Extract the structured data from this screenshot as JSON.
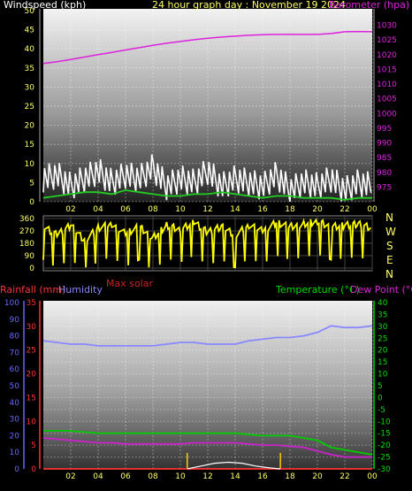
{
  "header": {
    "left": "Windspeed (kph)",
    "center": "24 hour graph day : November 19 2024",
    "right": "Barometer (hpa)"
  },
  "colors": {
    "barometer": "#dd22dd",
    "wind": "#ffffff",
    "wind_avg": "#22cc22",
    "direction": "#ffff00",
    "humidity": "#8888ff",
    "temperature": "#00cc00",
    "dewpoint": "#cc22cc",
    "rainfall": "#ff3333",
    "solar": "#ffffff",
    "axis_yellow": "#ffff66",
    "axis_green": "#00dd00",
    "axis_magenta": "#dd22dd",
    "axis_blue": "#6666ff",
    "axis_red": "#ff3333"
  },
  "x_ticks": [
    "02",
    "04",
    "06",
    "08",
    "10",
    "12",
    "14",
    "16",
    "18",
    "20",
    "22",
    "00"
  ],
  "panel2_labels": {
    "compass": [
      "N",
      "W",
      "S",
      "E",
      "N"
    ],
    "max_solar": "Max solar"
  },
  "panel3_header": {
    "rainfall": "Rainfall (mm)",
    "humidity": "Humidity",
    "temperature": "Temperature (°C)",
    "dewpoint": "Dew Point (°C)"
  },
  "chart_data": [
    {
      "type": "line",
      "x_range_hours": [
        0,
        24
      ],
      "axes": {
        "left": {
          "label": "Windspeed (kph)",
          "ylim": [
            0,
            50
          ],
          "ticks": [
            "0",
            "5",
            "10",
            "15",
            "20",
            "25",
            "30",
            "35",
            "40",
            "45",
            "50"
          ]
        },
        "right": {
          "label": "Barometer (hpa)",
          "ylim": [
            970,
            1035
          ],
          "ticks": [
            "975",
            "980",
            "985",
            "990",
            "995",
            "1000",
            "1005",
            "1010",
            "1015",
            "1020",
            "1025",
            "1030"
          ]
        }
      },
      "series": [
        {
          "name": "Barometer (hpa)",
          "axis": "right",
          "color": "#dd22dd",
          "x": [
            0,
            1,
            2,
            3,
            4,
            5,
            6,
            7,
            8,
            9,
            10,
            11,
            12,
            13,
            14,
            15,
            16,
            17,
            18,
            19,
            20,
            21,
            22,
            23,
            24
          ],
          "y": [
            1017,
            1017.6,
            1018.4,
            1019.2,
            1020,
            1020.8,
            1021.6,
            1022.4,
            1023.2,
            1023.9,
            1024.5,
            1025.1,
            1025.6,
            1026,
            1026.3,
            1026.6,
            1026.8,
            1026.9,
            1026.9,
            1026.9,
            1026.9,
            1027.2,
            1027.8,
            1027.9,
            1027.8
          ]
        },
        {
          "name": "Windspeed (kph)",
          "axis": "left",
          "color": "#ffffff",
          "x": [
            0,
            1,
            2,
            3,
            4,
            5,
            6,
            7,
            8,
            9,
            10,
            11,
            12,
            13,
            14,
            15,
            16,
            17,
            18,
            19,
            20,
            21,
            22,
            23,
            24
          ],
          "y": [
            6,
            7,
            4,
            6,
            8,
            5,
            7,
            6,
            9,
            4,
            6,
            5,
            8,
            4,
            6,
            5,
            4,
            7,
            3,
            5,
            4,
            6,
            3,
            5,
            4
          ]
        },
        {
          "name": "Average windspeed",
          "axis": "left",
          "color": "#22cc22",
          "x": [
            0,
            1,
            2,
            3,
            4,
            5,
            6,
            7,
            8,
            9,
            10,
            11,
            12,
            13,
            14,
            15,
            16,
            17,
            18,
            19,
            20,
            21,
            22,
            23,
            24
          ],
          "y": [
            1,
            1.5,
            2,
            2.5,
            2.5,
            2,
            3,
            2.5,
            2,
            1.5,
            1.5,
            2,
            2,
            2.5,
            2,
            1.5,
            1,
            1.5,
            1.5,
            1,
            1,
            1,
            0.5,
            1,
            1
          ]
        }
      ]
    },
    {
      "type": "line",
      "x_range_hours": [
        0,
        24
      ],
      "axes": {
        "left": {
          "ylim": [
            0,
            360
          ],
          "ticks": [
            "0",
            "90",
            "180",
            "270",
            "360"
          ]
        }
      },
      "series": [
        {
          "name": "Wind direction",
          "color": "#ffff00",
          "x": [
            0,
            1,
            2,
            3,
            4,
            5,
            6,
            7,
            8,
            9,
            10,
            11,
            12,
            13,
            14,
            15,
            16,
            17,
            18,
            19,
            20,
            21,
            22,
            23,
            24
          ],
          "y": [
            300,
            240,
            310,
            200,
            290,
            320,
            250,
            300,
            220,
            310,
            280,
            330,
            260,
            300,
            240,
            310,
            270,
            330,
            300,
            320,
            340,
            300,
            310,
            320,
            290
          ]
        }
      ]
    },
    {
      "type": "line",
      "x_range_hours": [
        0,
        24
      ],
      "axes": {
        "left_outer": {
          "label": "Humidity",
          "ylim": [
            0,
            100
          ],
          "ticks": [
            "0",
            "10",
            "20",
            "30",
            "40",
            "50",
            "60",
            "70",
            "80",
            "90",
            "100"
          ]
        },
        "left_inner": {
          "label": "Rainfall (mm)",
          "ylim": [
            0,
            35
          ],
          "ticks": [
            "0",
            "5",
            "10",
            "15",
            "20",
            "25",
            "30",
            "35"
          ]
        },
        "right": {
          "label": "Temperature (°C)",
          "ylim": [
            -30,
            40
          ],
          "ticks": [
            "-30",
            "-25",
            "-20",
            "-15",
            "-10",
            "-5",
            "0",
            "5",
            "10",
            "15",
            "20",
            "25",
            "30",
            "35",
            "40"
          ]
        }
      },
      "series": [
        {
          "name": "Humidity",
          "axis": "left_outer",
          "color": "#8888ff",
          "x": [
            0,
            1,
            2,
            3,
            4,
            5,
            6,
            7,
            8,
            9,
            10,
            11,
            12,
            13,
            14,
            15,
            16,
            17,
            18,
            19,
            20,
            21,
            22,
            23,
            24
          ],
          "y": [
            77,
            76,
            75,
            75,
            74,
            74,
            74,
            74,
            74,
            75,
            76,
            76,
            75,
            75,
            75,
            77,
            78,
            79,
            79,
            80,
            82,
            86,
            85,
            85,
            86
          ]
        },
        {
          "name": "Temperature (°C)",
          "axis": "right",
          "color": "#00cc00",
          "x": [
            0,
            1,
            2,
            3,
            4,
            5,
            6,
            7,
            8,
            9,
            10,
            11,
            12,
            13,
            14,
            15,
            16,
            17,
            18,
            19,
            20,
            21,
            22,
            23,
            24
          ],
          "y": [
            -14,
            -14,
            -14,
            -14.5,
            -15,
            -15,
            -15,
            -15,
            -15,
            -15,
            -15,
            -15,
            -15,
            -15,
            -15,
            -15.5,
            -16,
            -16,
            -16,
            -17,
            -18,
            -21,
            -22,
            -23,
            -24
          ]
        },
        {
          "name": "Dew Point (°C)",
          "axis": "right",
          "color": "#cc22cc",
          "x": [
            0,
            1,
            2,
            3,
            4,
            5,
            6,
            7,
            8,
            9,
            10,
            11,
            12,
            13,
            14,
            15,
            16,
            17,
            18,
            19,
            20,
            21,
            22,
            23,
            24
          ],
          "y": [
            -17,
            -17.5,
            -18,
            -18.5,
            -19,
            -19,
            -19.5,
            -19.5,
            -19.5,
            -19.5,
            -19.5,
            -19,
            -19,
            -19,
            -19,
            -19.5,
            -20,
            -20,
            -20.5,
            -21,
            -22.5,
            -24,
            -25,
            -25,
            -25
          ]
        },
        {
          "name": "Rainfall (mm)",
          "axis": "left_inner",
          "color": "#ff3333",
          "x": [
            0,
            24
          ],
          "y": [
            0,
            0
          ]
        },
        {
          "name": "Max solar",
          "axis": "left_inner",
          "color": "#ffffff",
          "x": [
            10.5,
            11.5,
            12.5,
            13.5,
            14.5,
            15.5,
            16.5,
            17.3
          ],
          "y": [
            0,
            0.6,
            1.2,
            1.4,
            1.2,
            0.6,
            0.2,
            0
          ]
        }
      ],
      "markers_hours": [
        10.5,
        17.3
      ]
    }
  ]
}
